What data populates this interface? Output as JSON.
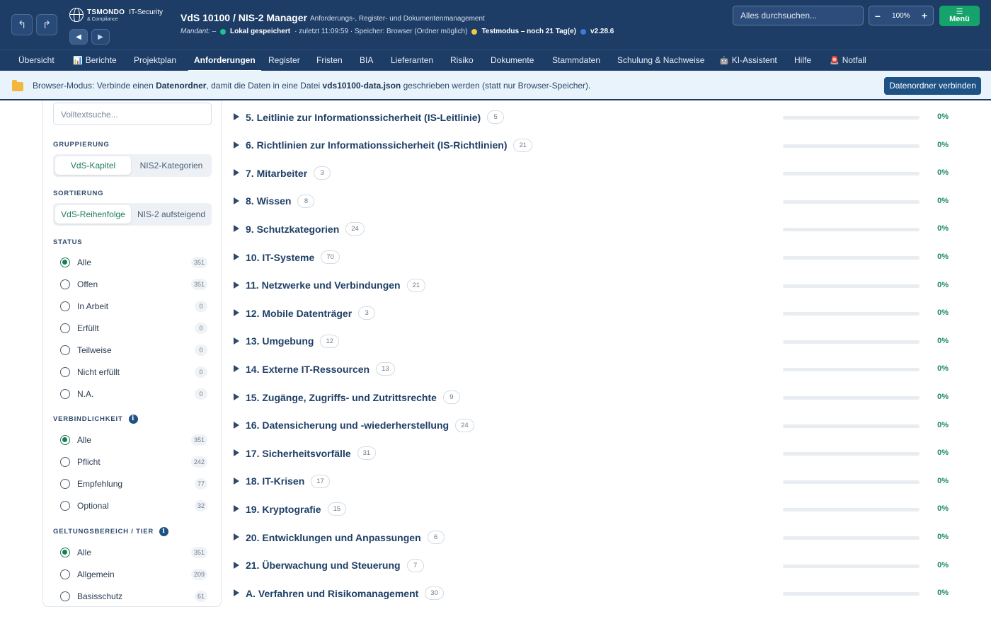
{
  "header": {
    "back_icon": "undo-arrow-icon",
    "forward_icon": "redo-arrow-icon",
    "prev_icon": "triangle-left-icon",
    "next_icon": "triangle-right-icon",
    "logo_name": "TSMONDO",
    "logo_it": "IT-Security",
    "logo_sub": "& Compliance",
    "title": "VdS 10100 / NIS-2 Manager",
    "subtitle": "Anforderungs-, Register- und Dokumentenmanagement",
    "mandant_label": "Mandant: –",
    "save_status": "Lokal gespeichert",
    "last_saved": "· zuletzt 11:09:59 · Speicher: Browser (Ordner möglich)",
    "test_mode": "Testmodus – noch 21 Tag(e)",
    "version": "v2.28.6",
    "search_placeholder": "Alles durchsuchen...",
    "zoom_minus": "–",
    "zoom_level": "100%",
    "zoom_plus": "+",
    "menu_icon": "☰",
    "menu_label": "Menü",
    "colors": {
      "status_green": "#1fc28a",
      "status_yellow": "#f4c542",
      "version_blue": "#3e7ad6"
    }
  },
  "tabs": [
    {
      "label": "Übersicht",
      "icon": ""
    },
    {
      "label": "Berichte",
      "icon": "📊"
    },
    {
      "label": "Projektplan",
      "icon": ""
    },
    {
      "label": "Anforderungen",
      "icon": ""
    },
    {
      "label": "Register",
      "icon": ""
    },
    {
      "label": "Fristen",
      "icon": ""
    },
    {
      "label": "BIA",
      "icon": ""
    },
    {
      "label": "Lieferanten",
      "icon": ""
    },
    {
      "label": "Risiko",
      "icon": ""
    },
    {
      "label": "Dokumente",
      "icon": ""
    },
    {
      "label": "Stammdaten",
      "icon": ""
    },
    {
      "label": "Schulung & Nachweise",
      "icon": ""
    },
    {
      "label": "KI-Assistent",
      "icon": "🤖"
    },
    {
      "label": "Hilfe",
      "icon": ""
    },
    {
      "label": "Notfall",
      "icon": "🚨"
    }
  ],
  "banner": {
    "text_1": "Browser-Modus: Verbinde einen ",
    "text_bold_1": "Datenordner",
    "text_2": ", damit die Daten in eine Datei ",
    "text_bold_2": "vds10100-data.json",
    "text_3": " geschrieben werden (statt nur Browser-Speicher).",
    "button": "Datenordner verbinden"
  },
  "sidebar": {
    "fulltext_placeholder": "Volltextsuche...",
    "grouping_title": "GRUPPIERUNG",
    "grouping_options": [
      "VdS-Kapitel",
      "NIS2-Kategorien"
    ],
    "sorting_title": "SORTIERUNG",
    "sorting_options": [
      "VdS-Reihenfolge",
      "NIS-2 aufsteigend"
    ],
    "status_title": "STATUS",
    "status": [
      {
        "label": "Alle",
        "count": "351",
        "selected": true
      },
      {
        "label": "Offen",
        "count": "351"
      },
      {
        "label": "In Arbeit",
        "count": "0"
      },
      {
        "label": "Erfüllt",
        "count": "0"
      },
      {
        "label": "Teilweise",
        "count": "0"
      },
      {
        "label": "Nicht erfüllt",
        "count": "0"
      },
      {
        "label": "N.A.",
        "count": "0"
      }
    ],
    "binding_title": "VERBINDLICHKEIT",
    "binding": [
      {
        "label": "Alle",
        "count": "351",
        "selected": true
      },
      {
        "label": "Pflicht",
        "count": "242"
      },
      {
        "label": "Empfehlung",
        "count": "77"
      },
      {
        "label": "Optional",
        "count": "32"
      }
    ],
    "scope_title": "GELTUNGSBEREICH / TIER",
    "scope": [
      {
        "label": "Alle",
        "count": "351",
        "selected": true
      },
      {
        "label": "Allgemein",
        "count": "209"
      },
      {
        "label": "Basisschutz",
        "count": "61"
      }
    ],
    "info_icon": "i"
  },
  "chapters": [
    {
      "title": "5. Leitlinie zur Informationssicherheit (IS-Leitlinie)",
      "count": "5",
      "progress": 0,
      "percent": "0%"
    },
    {
      "title": "6. Richtlinien zur Informationssicherheit (IS-Richtlinien)",
      "count": "21",
      "progress": 0,
      "percent": "0%"
    },
    {
      "title": "7. Mitarbeiter",
      "count": "3",
      "progress": 0,
      "percent": "0%"
    },
    {
      "title": "8. Wissen",
      "count": "8",
      "progress": 0,
      "percent": "0%"
    },
    {
      "title": "9. Schutzkategorien",
      "count": "24",
      "progress": 0,
      "percent": "0%"
    },
    {
      "title": "10. IT-Systeme",
      "count": "70",
      "progress": 0,
      "percent": "0%"
    },
    {
      "title": "11. Netzwerke und Verbindungen",
      "count": "21",
      "progress": 0,
      "percent": "0%"
    },
    {
      "title": "12. Mobile Datenträger",
      "count": "3",
      "progress": 0,
      "percent": "0%"
    },
    {
      "title": "13. Umgebung",
      "count": "12",
      "progress": 0,
      "percent": "0%"
    },
    {
      "title": "14. Externe IT-Ressourcen",
      "count": "13",
      "progress": 0,
      "percent": "0%"
    },
    {
      "title": "15. Zugänge, Zugriffs- und Zutrittsrechte",
      "count": "9",
      "progress": 0,
      "percent": "0%"
    },
    {
      "title": "16. Datensicherung und -wiederherstellung",
      "count": "24",
      "progress": 0,
      "percent": "0%"
    },
    {
      "title": "17. Sicherheitsvorfälle",
      "count": "31",
      "progress": 0,
      "percent": "0%"
    },
    {
      "title": "18. IT-Krisen",
      "count": "17",
      "progress": 0,
      "percent": "0%"
    },
    {
      "title": "19. Kryptografie",
      "count": "15",
      "progress": 0,
      "percent": "0%"
    },
    {
      "title": "20. Entwicklungen und Anpassungen",
      "count": "6",
      "progress": 0,
      "percent": "0%"
    },
    {
      "title": "21. Überwachung und Steuerung",
      "count": "7",
      "progress": 0,
      "percent": "0%"
    },
    {
      "title": "A. Verfahren und Risikomanagement",
      "count": "30",
      "progress": 0,
      "percent": "0%"
    }
  ]
}
